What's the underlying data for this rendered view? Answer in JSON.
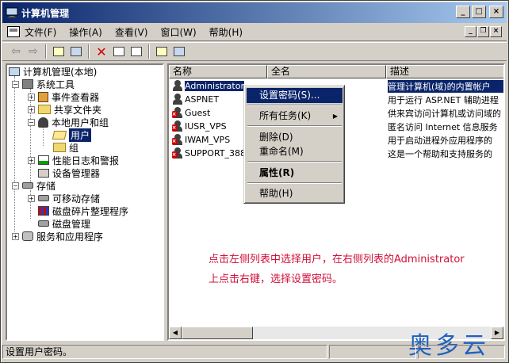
{
  "window": {
    "title": "计算机管理"
  },
  "menubar": {
    "items": [
      "文件(F)",
      "操作(A)",
      "查看(V)",
      "窗口(W)",
      "帮助(H)"
    ]
  },
  "tree": {
    "root": "计算机管理(本地)",
    "system_tools": "系统工具",
    "event_viewer": "事件查看器",
    "shared_folders": "共享文件夹",
    "local_users_groups": "本地用户和组",
    "users": "用户",
    "groups": "组",
    "perf_logs": "性能日志和警报",
    "device_manager": "设备管理器",
    "storage": "存储",
    "removable_storage": "可移动存储",
    "defrag": "磁盘碎片整理程序",
    "disk_mgmt": "磁盘管理",
    "services_apps": "服务和应用程序"
  },
  "list": {
    "columns": [
      "名称",
      "全名",
      "描述"
    ],
    "rows": [
      {
        "name": "Administrator",
        "full": "",
        "desc": "管理计算机(域)的内置帐户",
        "disabled": false,
        "selected": true
      },
      {
        "name": "ASPNET",
        "full": "户",
        "desc": "用于运行 ASP.NET 辅助进程",
        "disabled": false,
        "selected": false
      },
      {
        "name": "Guest",
        "full": "",
        "desc": "供来宾访问计算机或访问域的",
        "disabled": true,
        "selected": false
      },
      {
        "name": "IUSR_VPS",
        "full": "",
        "desc": "匿名访问 Internet 信息服务",
        "disabled": true,
        "selected": false
      },
      {
        "name": "IWAM_VPS",
        "full": "",
        "desc": "用于启动进程外应用程序的",
        "disabled": true,
        "selected": false
      },
      {
        "name": "SUPPORT_3889",
        "full": "pora...",
        "desc": "这是一个帮助和支持服务的",
        "disabled": true,
        "selected": false
      }
    ]
  },
  "context_menu": {
    "set_password": "设置密码(S)...",
    "all_tasks": "所有任务(K)",
    "delete": "删除(D)",
    "rename": "重命名(M)",
    "properties": "属性(R)",
    "help": "帮助(H)"
  },
  "annotation": {
    "line1": "点击左侧列表中选择用户，在右侧列表的Administrator",
    "line2": "上点击右键，选择设置密码。"
  },
  "watermark": "奥多云",
  "statusbar": {
    "text": "设置用户密码。"
  },
  "colors": {
    "title_start": "#0a246a",
    "title_end": "#a6caf0",
    "selection": "#0a246a",
    "annotation": "#d0103a",
    "watermark": "#2060c0"
  }
}
